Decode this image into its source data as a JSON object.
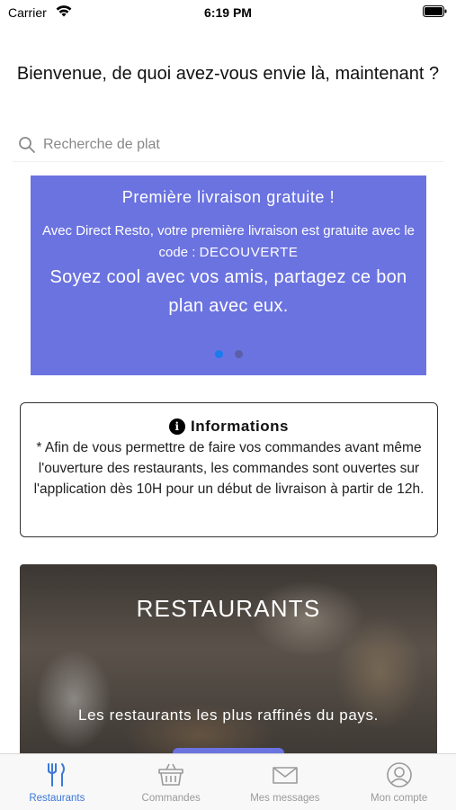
{
  "status_bar": {
    "carrier": "Carrier",
    "time": "6:19 PM"
  },
  "header": {
    "welcome": "Bienvenue, de quoi avez-vous envie là, maintenant ?"
  },
  "search": {
    "placeholder": "Recherche de plat",
    "value": ""
  },
  "promo": {
    "title": "Première livraison gratuite !",
    "text": "Avec Direct Resto, votre première livraison est gratuite avec le code :",
    "code": "DECOUVERTE",
    "tagline": "Soyez cool avec vos amis, partagez ce bon plan avec eux.",
    "slides_total": 2,
    "active_slide": 1,
    "background_color": "#6b73e0"
  },
  "info": {
    "title": "Informations",
    "icon": "info-icon",
    "text": "* Afin de vous permettre de faire vos commandes avant même l'ouverture des restaurants, les commandes sont ouvertes sur l'application dès 10H pour un début de livraison à partir de 12h."
  },
  "restaurants_card": {
    "title": "RESTAURANTS",
    "subtitle": "Les restaurants les plus raffinés du pays."
  },
  "tab_bar": {
    "active_color": "#3c78d8",
    "inactive_color": "#9a9a9a",
    "items": [
      {
        "label": "Restaurants",
        "icon": "cutlery-icon",
        "active": true
      },
      {
        "label": "Commandes",
        "icon": "basket-icon",
        "active": false
      },
      {
        "label": "Mes messages",
        "icon": "envelope-icon",
        "active": false
      },
      {
        "label": "Mon compte",
        "icon": "user-icon",
        "active": false
      }
    ]
  }
}
